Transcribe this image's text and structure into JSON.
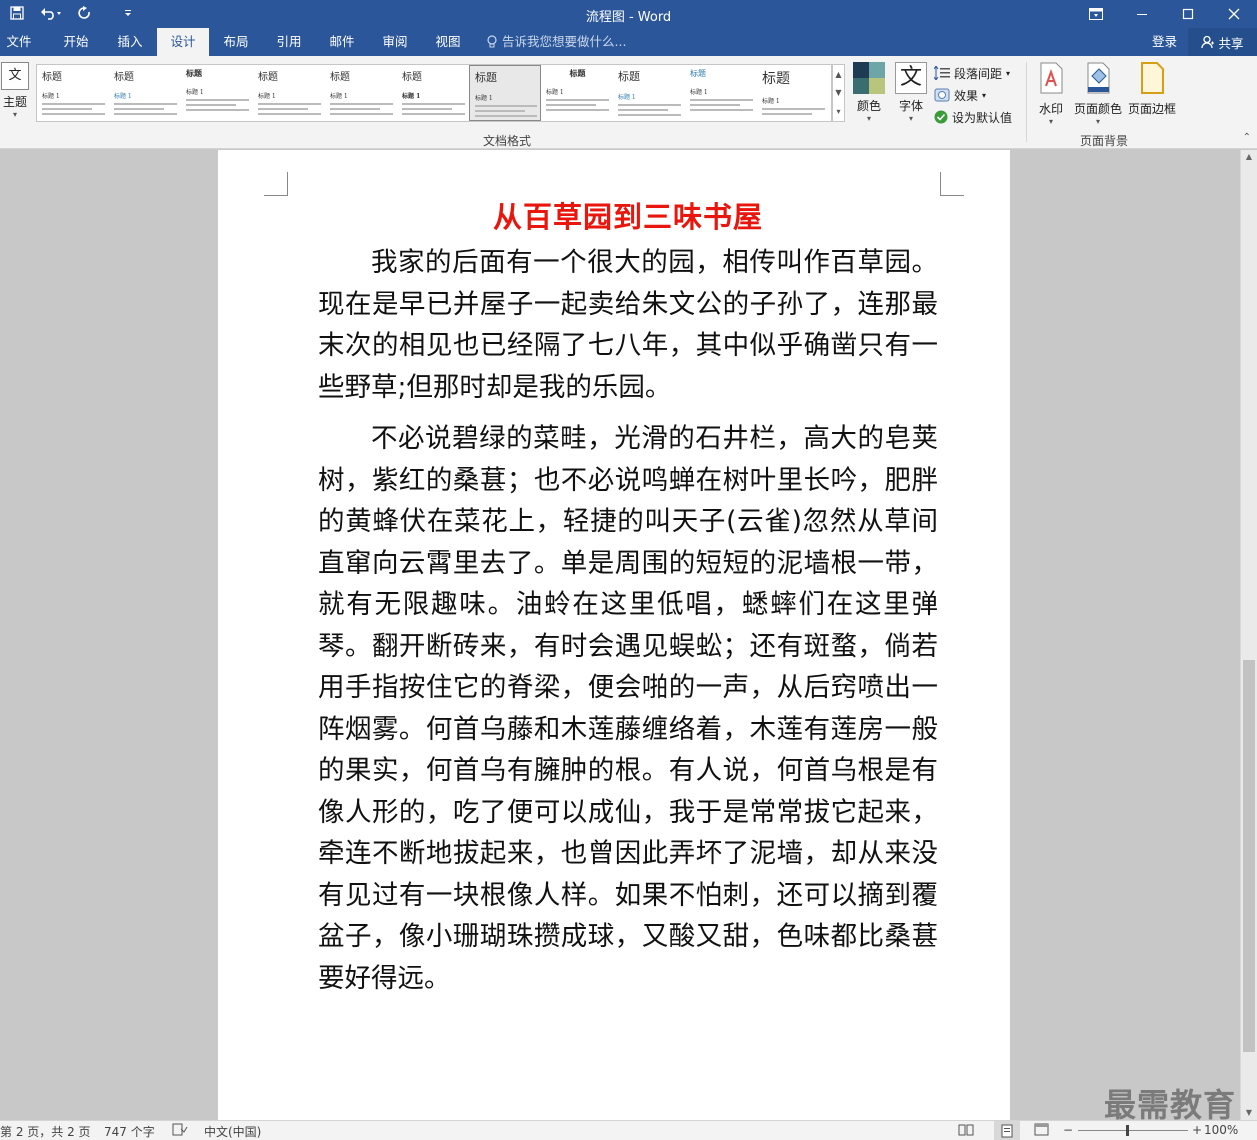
{
  "window": {
    "title": "流程图 - Word"
  },
  "tabs": [
    {
      "label": "文件"
    },
    {
      "label": "开始"
    },
    {
      "label": "插入"
    },
    {
      "label": "设计"
    },
    {
      "label": "布局"
    },
    {
      "label": "引用"
    },
    {
      "label": "邮件"
    },
    {
      "label": "审阅"
    },
    {
      "label": "视图"
    }
  ],
  "tellme": {
    "placeholder": "告诉我您想要做什么..."
  },
  "account": {
    "login": "登录",
    "share": "共享"
  },
  "ribbon": {
    "theme_label": "主题",
    "theme_icon_text": "文",
    "gallery": [
      {
        "title": "标题",
        "sub": "标题 1"
      },
      {
        "title": "标题",
        "sub": "标题 1"
      },
      {
        "title": "标题",
        "sub": "标题 1"
      },
      {
        "title": "标题",
        "sub": "标题 1"
      },
      {
        "title": "标题",
        "sub": "标题 1"
      },
      {
        "title": "标题",
        "sub": "标题 1"
      },
      {
        "title": "标题",
        "sub": "标题 1"
      },
      {
        "title": "标题",
        "sub": "标题 1"
      },
      {
        "title": "标题",
        "sub": "标题 1"
      },
      {
        "title": "标题",
        "sub": "标题 1"
      },
      {
        "title": "标题",
        "sub": "标题 1"
      }
    ],
    "doc_format_label": "文档格式",
    "colors_label": "颜色",
    "fonts_label": "字体",
    "fonts_icon_text": "文",
    "paragraph_spacing": "段落间距",
    "effects": "效果",
    "set_default": "设为默认值",
    "watermark": "水印",
    "page_color": "页面颜色",
    "page_borders": "页面边框",
    "page_bg_label": "页面背景",
    "swatch_colors": [
      "#1f3b53",
      "#6ea6a8",
      "#3a6d70",
      "#b9c57c"
    ]
  },
  "document": {
    "title": "从百草园到三味书屋",
    "paragraphs": [
      "我家的后面有一个很大的园，相传叫作百草园。现在是早已并屋子一起卖给朱文公的子孙了，连那最末次的相见也已经隔了七八年，其中似乎确凿只有一些野草;但那时却是我的乐园。",
      "不必说碧绿的菜畦，光滑的石井栏，高大的皂荚树，紫红的桑葚；也不必说鸣蝉在树叶里长吟，肥胖的黄蜂伏在菜花上，轻捷的叫天子(云雀)忽然从草间直窜向云霄里去了。单是周围的短短的泥墙根一带，就有无限趣味。油蛉在这里低唱，蟋蟀们在这里弹琴。翻开断砖来，有时会遇见蜈蚣；还有斑蝥，倘若用手指按住它的脊梁，便会啪的一声，从后窍喷出一阵烟雾。何首乌藤和木莲藤缠络着，木莲有莲房一般的果实，何首乌有臃肿的根。有人说，何首乌根是有像人形的，吃了便可以成仙，我于是常常拔它起来，牵连不断地拔起来，也曾因此弄坏了泥墙，却从来没有见过有一块根像人样。如果不怕刺，还可以摘到覆盆子，像小珊瑚珠攒成球，又酸又甜，色味都比桑葚要好得远。"
    ]
  },
  "status": {
    "page": "第 2 页，共 2 页",
    "words": "747 个字",
    "language": "中文(中国)",
    "zoom": "100%"
  },
  "watermark_text": "最需教育",
  "colors": {
    "accent": "#2b579a",
    "title_red": "#e8160c"
  }
}
